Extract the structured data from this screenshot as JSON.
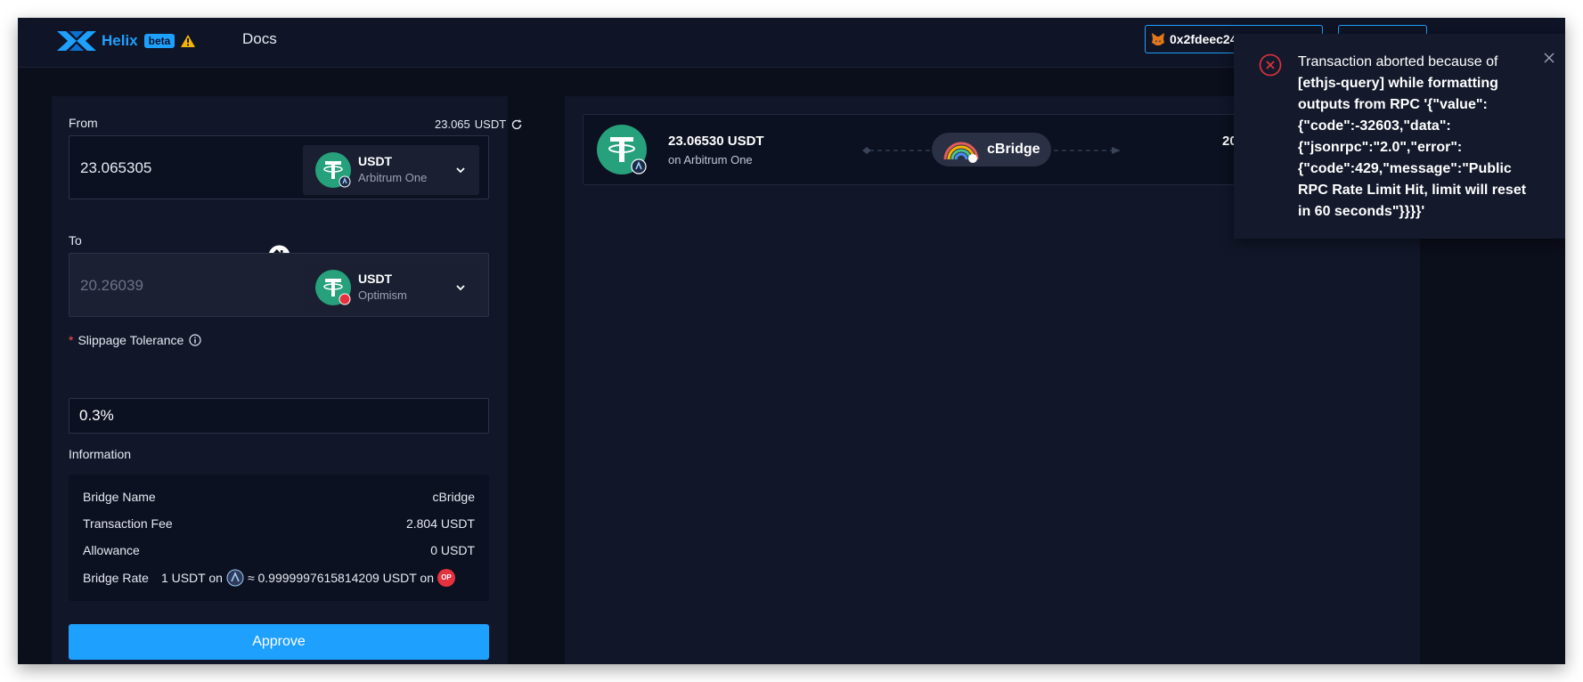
{
  "header": {
    "logo_text": "Helix",
    "beta_label": "beta",
    "docs_label": "Docs",
    "wallet_address": "0x2fdeec24"
  },
  "from": {
    "label": "From",
    "balance": "23.065",
    "balance_unit": "USDT",
    "amount": "23.065305",
    "token": "USDT",
    "network": "Arbitrum One"
  },
  "to": {
    "label": "To",
    "amount": "20.26039",
    "token": "USDT",
    "network": "Optimism"
  },
  "slippage": {
    "label": "Slippage Tolerance",
    "value": "0.3%"
  },
  "information": {
    "label": "Information",
    "rows": [
      {
        "key": "Bridge Name",
        "value": "cBridge"
      },
      {
        "key": "Transaction Fee",
        "value": "2.804 USDT"
      },
      {
        "key": "Allowance",
        "value": "0 USDT"
      }
    ],
    "bridge_rate": {
      "key": "Bridge Rate",
      "left": "1 USDT on",
      "right": "≈ 0.9999997615814209 USDT on",
      "dest_badge": "OP"
    }
  },
  "approve_label": "Approve",
  "route": {
    "amount": "23.06530 USDT",
    "network": "on Arbitrum One",
    "bridge": "cBridge",
    "dest_amount_partial": "20"
  },
  "toast": {
    "message_first": "Transaction aborted because of ",
    "message_rest": "[ethjs-query] while formatting outputs from RPC '{\"value\":{\"code\":-32603,\"data\":{\"jsonrpc\":\"2.0\",\"error\":{\"code\":429,\"message\":\"Public RPC Rate Limit Hit, limit will reset in 60 seconds\"}}}}'"
  },
  "colors": {
    "accent": "#1ea0ff",
    "tether_green": "#26a17b",
    "error_red": "#e5323e"
  }
}
